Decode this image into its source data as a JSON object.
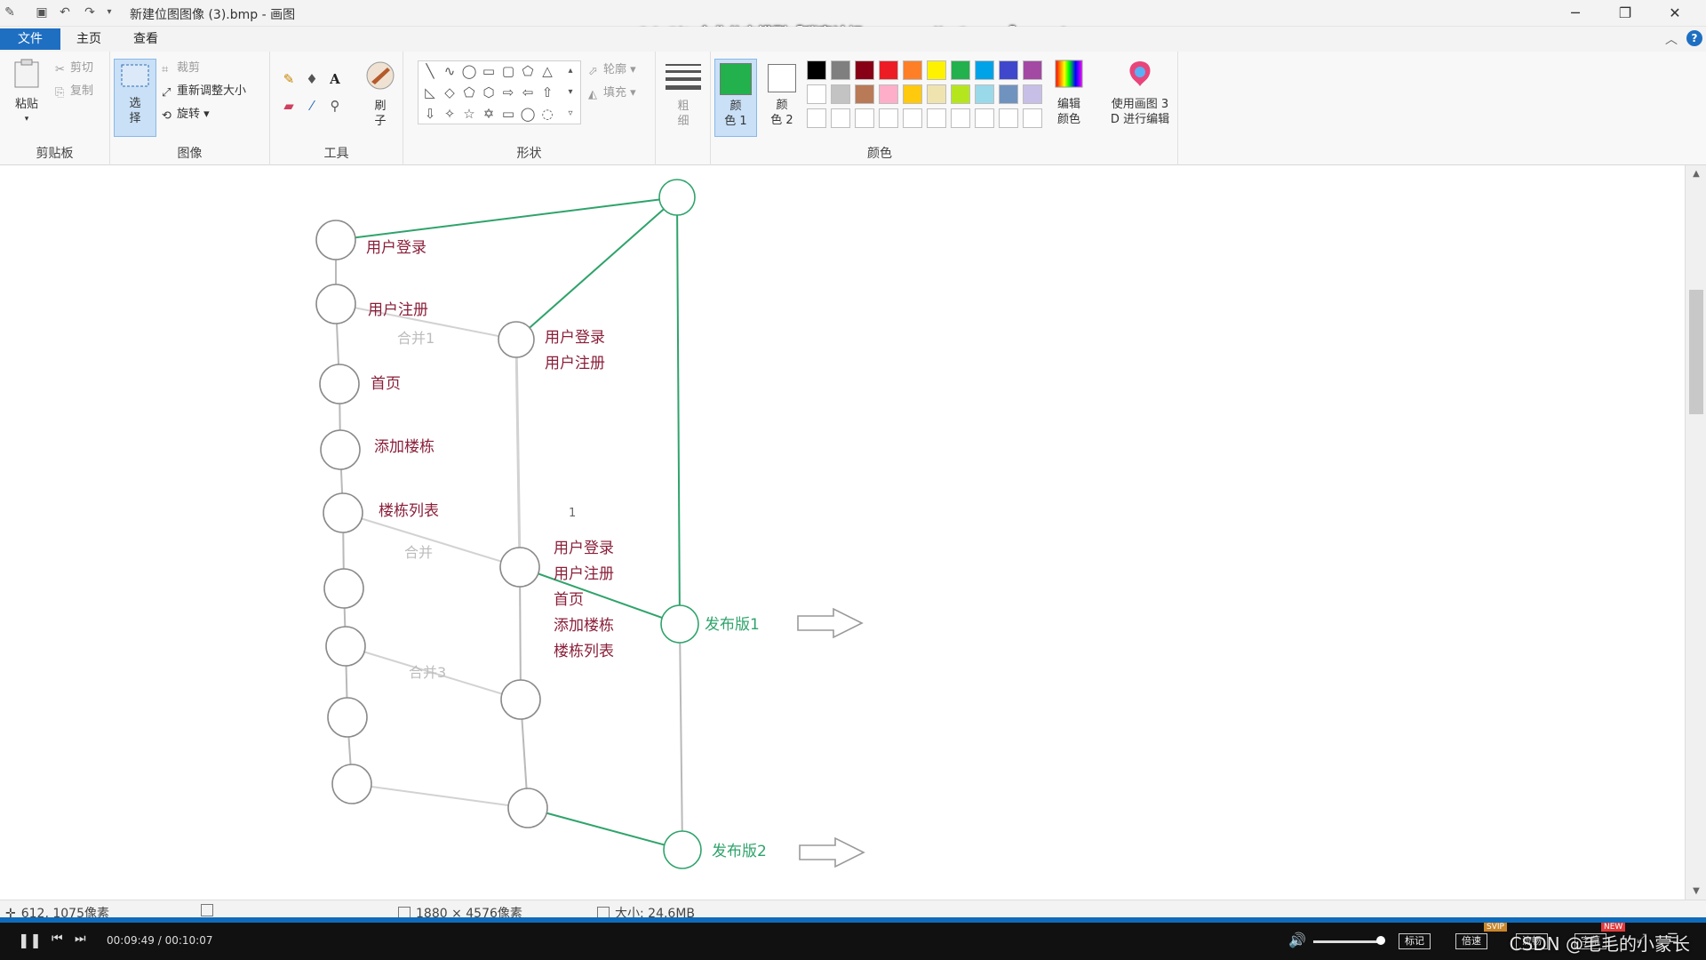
{
  "window": {
    "doc_title": "新建位图图像 (3).bmp - 画图",
    "video_title": "14-Git-企业分支模型【瑞客论坛 www.ruike1.com】.mp4"
  },
  "tabs": {
    "file": "文件",
    "home": "主页",
    "view": "查看"
  },
  "ribbon": {
    "clipboard": {
      "paste": "粘贴",
      "cut": "剪切",
      "copy": "复制",
      "label": "剪贴板"
    },
    "image": {
      "select_top": "选",
      "select_bottom": "择",
      "crop": "裁剪",
      "resize": "重新调整大小",
      "rotate": "旋转",
      "label": "图像"
    },
    "tools": {
      "label": "工具",
      "brush_top": "刷",
      "brush_bottom": "子"
    },
    "shapes": {
      "outline": "轮廓",
      "fill": "填充",
      "label": "形状"
    },
    "size": {
      "top": "粗",
      "bottom": "细"
    },
    "colors": {
      "color1_top": "颜",
      "color1_bottom": "色 1",
      "color2_top": "颜",
      "color2_bottom": "色 2",
      "edit_top": "编辑",
      "edit_bottom": "颜色",
      "paint3d_top": "使用画图 3",
      "paint3d_bottom": "D 进行编辑",
      "label": "颜色",
      "color1_value": "#22b14c",
      "color2_value": "#ffffff",
      "palette_row1": [
        "#000000",
        "#7f7f7f",
        "#880015",
        "#ed1c24",
        "#ff7f27",
        "#fff200",
        "#22b14c",
        "#00a2e8",
        "#3f48cc",
        "#a349a4"
      ],
      "palette_row2": [
        "#ffffff",
        "#c3c3c3",
        "#b97a57",
        "#ffaec9",
        "#ffc90e",
        "#efe4b0",
        "#b5e61d",
        "#99d9ea",
        "#7092be",
        "#c8bfe7"
      ]
    }
  },
  "canvas": {
    "master_labels": [
      "用户登录",
      "用户注册",
      "首页",
      "添加楼栋",
      "楼栋列表"
    ],
    "merge_labels": [
      "合并1",
      "合并",
      "合并3"
    ],
    "dev_block1": [
      "用户登录",
      "用户注册"
    ],
    "dev_block2": [
      "用户登录",
      "用户注册",
      "首页",
      "添加楼栋",
      "楼栋列表"
    ],
    "releases": [
      "发布版1",
      "发布版2"
    ],
    "stray_mark": "1",
    "line_color": "#2fa36b",
    "label_color": "#8a1f3a"
  },
  "status": {
    "cursor": "612, 1075像素",
    "dimensions": "1880 × 4576像素",
    "size": "大小: 24.6MB"
  },
  "player": {
    "time": "00:09:49 / 00:10:07",
    "btn_mark": "标记",
    "btn_speed": "倍速",
    "btn_smooth": "流畅",
    "btn_subtitle": "字幕",
    "badge_svip": "SVIP",
    "badge_new": "NEW",
    "watermark": "CSDN @毛毛的小蒙长"
  }
}
